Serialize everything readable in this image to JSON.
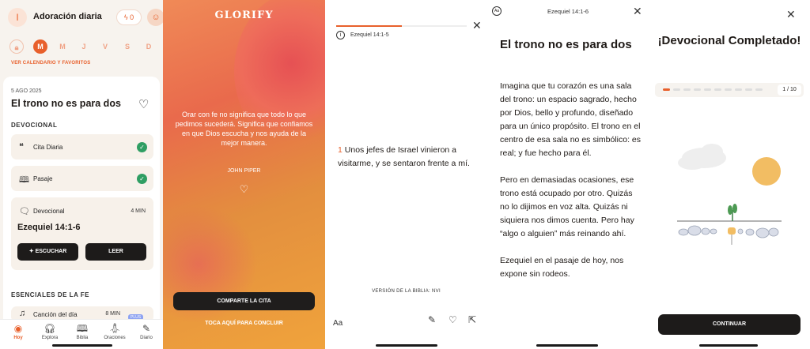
{
  "colors": {
    "accent": "#e8602c",
    "success": "#2f9e63",
    "dark_button": "#1d1b1a",
    "plus_badge": "#8ea3f2"
  },
  "home": {
    "avatar_initial": "I",
    "title": "Adoración diaria",
    "streak_count": "0",
    "streak_icon": "lightning-icon",
    "days": [
      "M",
      "M",
      "J",
      "V",
      "S",
      "D"
    ],
    "selected_day": "M",
    "calendar_link": "VER CALENDARIO Y FAVORITOS",
    "date": "5 AGO 2025",
    "devotional_title": "El trono no es para dos",
    "section_devotional": "DEVOCIONAL",
    "items": [
      {
        "label": "Cita Diaria",
        "icon": "quote-icon",
        "completed": true
      },
      {
        "label": "Pasaje",
        "icon": "book-icon",
        "completed": true
      }
    ],
    "devotional_card": {
      "label": "Devocional",
      "duration": "4 MIN",
      "passage": "Ezequiel 14:1-6",
      "listen_label": "ESCUCHAR",
      "read_label": "LEER"
    },
    "section_essentials": "ESENCIALES DE LA FE",
    "essential_item": {
      "label": "Canción del día",
      "duration": "8 MIN",
      "badge": "PLUS"
    },
    "tabs": [
      {
        "label": "Hoy",
        "icon": "home-icon",
        "active": true
      },
      {
        "label": "Explora",
        "icon": "headphones-icon",
        "active": false
      },
      {
        "label": "Biblia",
        "icon": "bible-icon",
        "active": false
      },
      {
        "label": "Oraciones",
        "icon": "praying-hands-icon",
        "active": false
      },
      {
        "label": "Diario",
        "icon": "pen-icon",
        "active": false
      }
    ]
  },
  "quote_screen": {
    "logo": "GLORIFY",
    "quote": "Orar con fe no significa que todo lo que pedimos sucederá. Significa que confiamos en que Dios escucha y nos ayuda de la mejor manera.",
    "author": "JOHN PIPER",
    "share_label": "COMPARTE LA CITA",
    "finish_label": "TOCA AQUÍ PARA CONCLUIR"
  },
  "passage_screen": {
    "progress": 0.5,
    "reference": "Ezequiel 14:1-5",
    "verse_number": "1",
    "verse_text": "Unos jefes de Israel vinieron a visitarme, y se sentaron frente a mí.",
    "version_label": "VERSIÓN DE LA BIBLIA: NVI",
    "font_label": "Aa"
  },
  "reading_screen": {
    "font_label": "Aa",
    "reference": "Ezequiel 14:1-6",
    "title": "El trono no es para dos",
    "paragraphs": [
      "Imagina que tu corazón es una sala del trono: un espacio sagrado, hecho por Dios, bello y profundo, diseñado para un único propósito.  El trono en el centro de esa sala no es simbólico: es real; y fue hecho para él.",
      "Pero en demasiadas ocasiones, ese trono está ocupado por otro.  Quizás no lo dijimos en voz alta.  Quizás ni siquiera nos dimos cuenta.  Pero hay “algo o alguien” más reinando ahí.",
      "Ezequiel en el pasaje de hoy, nos expone sin rodeos."
    ]
  },
  "complete_screen": {
    "title": "¡Devocional Completado!",
    "progress_current": 1,
    "progress_total": 10,
    "progress_label": "1 / 10",
    "continue_label": "CONTINUAR"
  }
}
